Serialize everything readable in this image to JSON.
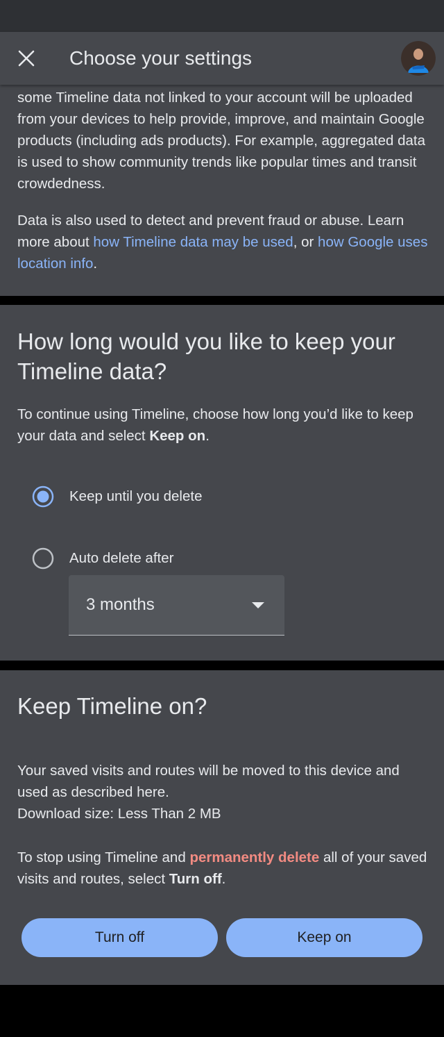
{
  "app_bar": {
    "title": "Choose your settings",
    "close_icon": "close-icon"
  },
  "section_usage": {
    "p1": "some Timeline data not linked to your account will be uploaded from your devices to help provide, improve, and maintain Google products (including ads products). For example, aggregated data is used to show community trends like popular times and transit crowdedness.",
    "p2_text": "Data is also used to detect and prevent fraud or abuse. Learn more about ",
    "p2_link1": "how Timeline data may be used",
    "p2_mid": ", or ",
    "p2_link2": "how Google uses location info",
    "p2_end": "."
  },
  "section_retention": {
    "heading": "How long would you like to keep your Timeline data?",
    "desc_text": "To continue using Timeline, choose how long you’d like to keep your data and select ",
    "desc_bold": "Keep on",
    "desc_end": ".",
    "options": [
      {
        "label": "Keep until you delete",
        "selected": true
      },
      {
        "label": "Auto delete after",
        "selected": false
      }
    ],
    "auto_delete_period": "3 months"
  },
  "section_keep_on": {
    "heading": "Keep Timeline on?",
    "line1": "Your saved visits and routes will be moved to this device and used as described here.",
    "line2": "Download size: Less Than 2 MB",
    "stop_text1": "To stop using Timeline and ",
    "stop_danger": "permanently delete",
    "stop_text2": " all of your saved visits and routes, select ",
    "stop_bold": "Turn off",
    "stop_end": ".",
    "turn_off_label": "Turn off",
    "keep_on_label": "Keep on"
  },
  "colors": {
    "accent": "#8ab4f8",
    "danger": "#f28b82",
    "surface": "#45474c",
    "app_bar": "#46484d"
  }
}
